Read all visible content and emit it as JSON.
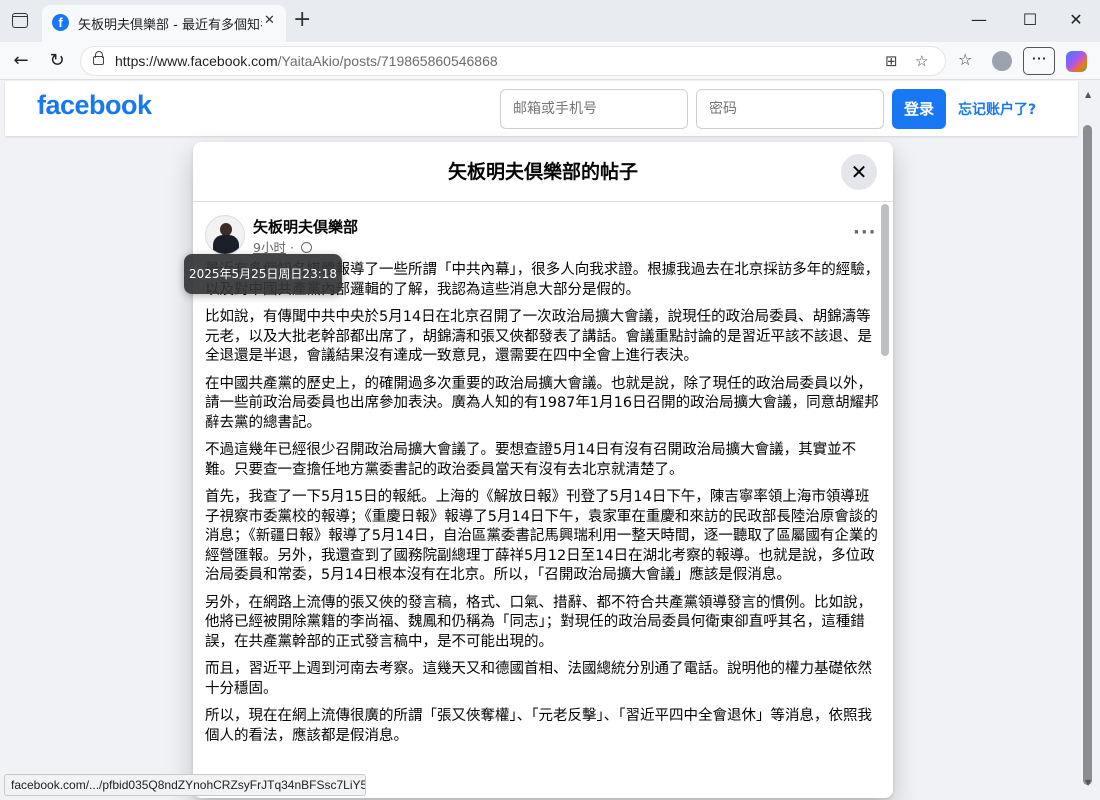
{
  "browser": {
    "tab_title": "矢板明夫倶樂部 - 最近有多個知名",
    "url_host": "https://www.facebook.com",
    "url_path": "/YaitaAkio/posts/719865860546868",
    "status_url": "facebook.com/.../pfbid035Q8ndZYnohCRZsyFrJTq34nBFSsc7LiY5..."
  },
  "header": {
    "logo": "facebook",
    "email_placeholder": "邮箱或手机号",
    "password_placeholder": "密码",
    "login_label": "登录",
    "forgot_label": "忘记账户了?"
  },
  "dialog": {
    "title": "矢板明夫倶樂部的帖子"
  },
  "post": {
    "author": "矢板明夫倶樂部",
    "time": "9小时",
    "separator": "·",
    "tooltip": "2025年5月25日周日23:18",
    "paragraphs": [
      "最近有多個知名媒體報導了一些所謂「中共內幕」，很多人向我求證。根據我過去在北京採訪多年的經驗，以及對中國共產黨內部邏輯的了解，我認為這些消息大部分是假的。",
      "比如說，有傳聞中共中央於5月14日在北京召開了一次政治局擴大會議，說現任的政治局委員、胡錦濤等元老，以及大批老幹部都出席了，胡錦濤和張又俠都發表了講話。會議重點討論的是習近平該不該退、是全退還是半退，會議結果沒有達成一致意見，還需要在四中全會上進行表決。",
      "在中國共產黨的歷史上，的確開過多次重要的政治局擴大會議。也就是說，除了現任的政治局委員以外，請一些前政治局委員也出席參加表決。廣為人知的有1987年1月16日召開的政治局擴大會議，同意胡耀邦辭去黨的總書記。",
      "不過這幾年已經很少召開政治局擴大會議了。要想查證5月14日有沒有召開政治局擴大會議，其實並不難。只要查一查擔任地方黨委書記的政治委員當天有沒有去北京就清楚了。",
      "首先，我查了一下5月15日的報紙。上海的《解放日報》刊登了5月14日下午，陳吉寧率領上海市領導班子視察市委黨校的報導；《重慶日報》報導了5月14日下午，袁家軍在重慶和來訪的民政部長陸治原會談的消息；《新疆日報》報導了5月14日，自治區黨委書記馬興瑞利用一整天時間，逐一聽取了區屬國有企業的經營匯報。另外，我還查到了國務院副總理丁薛祥5月12日至14日在湖北考察的報導。也就是說，多位政治局委員和常委，5月14日根本沒有在北京。所以，「召開政治局擴大會議」應該是假消息。",
      "另外，在網路上流傳的張又俠的發言稿，格式、口氣、措辭、都不符合共產黨領導發言的慣例。比如說，他將已經被開除黨籍的李尚福、魏鳳和仍稱為「同志」；對現任的政治局委員何衛東卻直呼其名，這種錯誤，在共產黨幹部的正式發言稿中，是不可能出現的。",
      "而且，習近平上週到河南去考察。這幾天又和德國首相、法國總統分別通了電話。說明他的權力基礎依然十分穩固。",
      "所以，現在在網上流傳很廣的所謂「張又俠奪權」、「元老反擊」、「習近平四中全會退休」等消息，依照我個人的看法，應該都是假消息。"
    ]
  }
}
